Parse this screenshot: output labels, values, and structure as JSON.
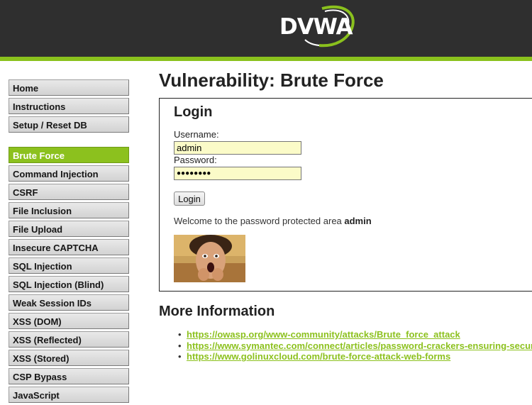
{
  "header": {
    "logo_text": "DVWA",
    "logo_name": "dvwa-logo"
  },
  "colors": {
    "header_bg": "#2f2f2f",
    "accent_green": "#8cc11e",
    "menu_bg": "#dcdcdc",
    "input_bg": "#fbfbc8"
  },
  "sidebar": {
    "top_items": [
      {
        "label": "Home"
      },
      {
        "label": "Instructions"
      },
      {
        "label": "Setup / Reset DB"
      }
    ],
    "vuln_items": [
      {
        "label": "Brute Force",
        "selected": true
      },
      {
        "label": "Command Injection"
      },
      {
        "label": "CSRF"
      },
      {
        "label": "File Inclusion"
      },
      {
        "label": "File Upload"
      },
      {
        "label": "Insecure CAPTCHA"
      },
      {
        "label": "SQL Injection"
      },
      {
        "label": "SQL Injection (Blind)"
      },
      {
        "label": "Weak Session IDs"
      },
      {
        "label": "XSS (DOM)"
      },
      {
        "label": "XSS (Reflected)"
      },
      {
        "label": "XSS (Stored)"
      },
      {
        "label": "CSP Bypass"
      },
      {
        "label": "JavaScript"
      }
    ]
  },
  "main": {
    "title": "Vulnerability: Brute Force",
    "login": {
      "heading": "Login",
      "username_label": "Username:",
      "username_value": "admin",
      "password_label": "Password:",
      "password_value": "●●●●●●●●",
      "button_label": "Login",
      "welcome_text": "Welcome to the password protected area ",
      "welcome_user": "admin"
    },
    "more_info": {
      "heading": "More Information",
      "links": [
        "https://owasp.org/www-community/attacks/Brute_force_attack",
        "https://www.symantec.com/connect/articles/password-crackers-ensuring-security-your-password",
        "https://www.golinuxcloud.com/brute-force-attack-web-forms"
      ]
    }
  }
}
